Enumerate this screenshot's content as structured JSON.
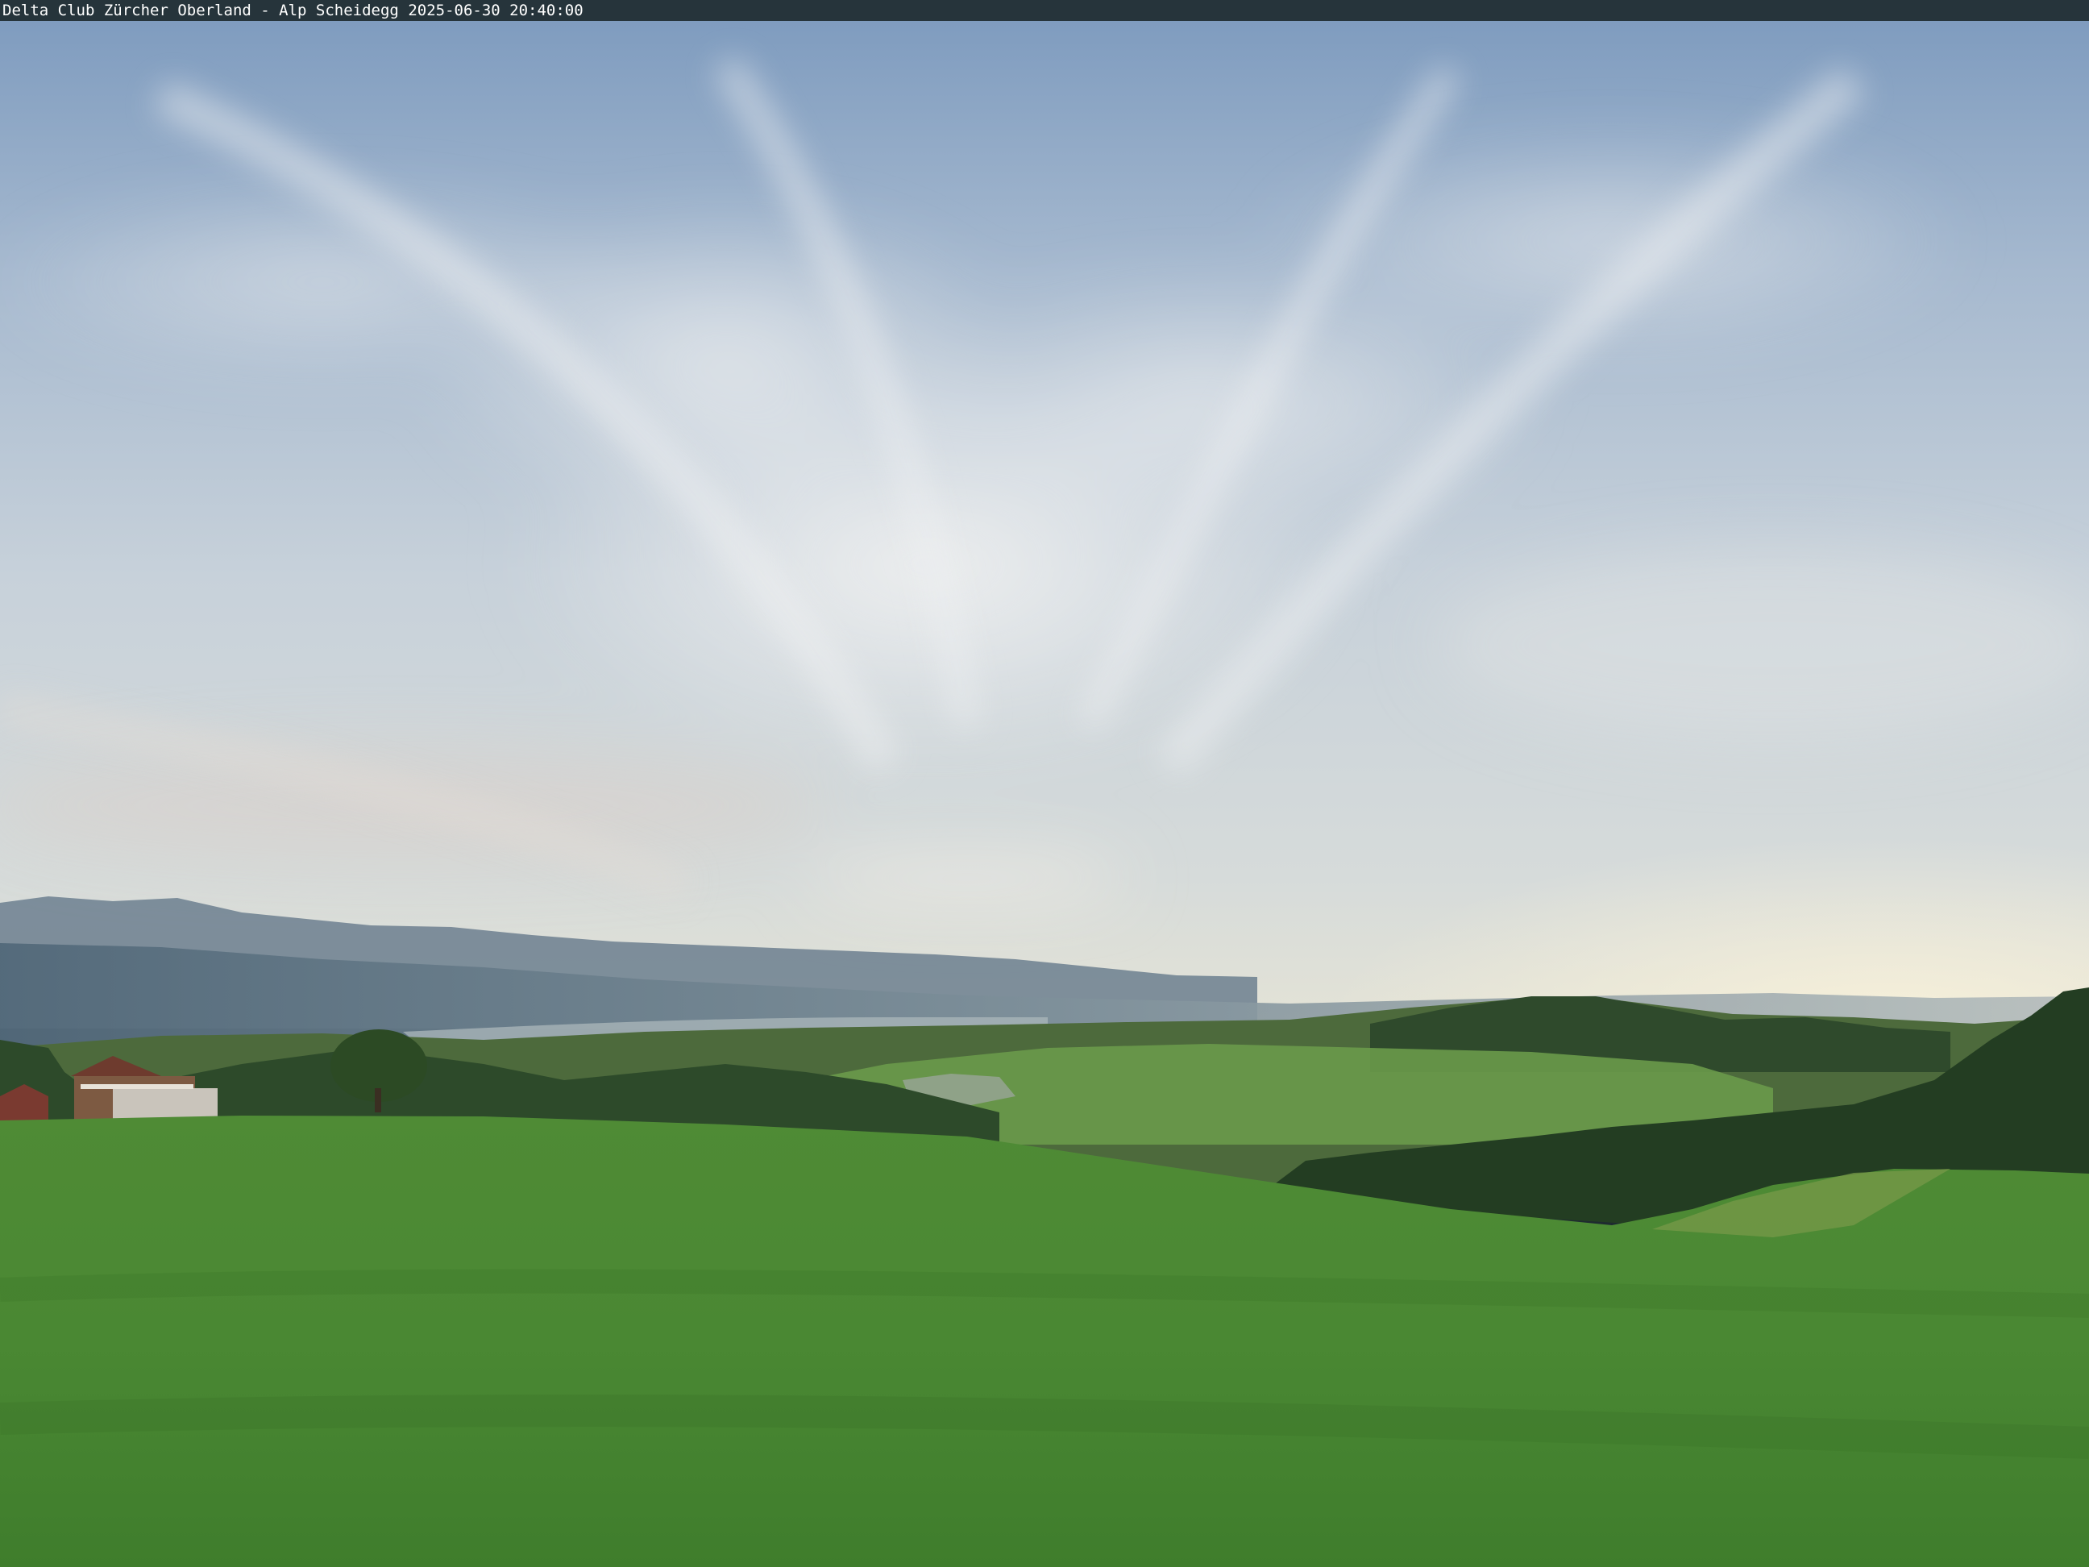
{
  "overlay": {
    "caption": "Delta Club Zürcher Oberland - Alp Scheidegg 2025-06-30 20:40:00"
  },
  "colors": {
    "sky_top": "#8ea7c4",
    "sky_mid": "#c9d3dc",
    "horizon_glow": "#f3ecd6",
    "mountains": "#5f7282",
    "forest": "#2c4a2a",
    "meadow": "#4e8a36"
  }
}
